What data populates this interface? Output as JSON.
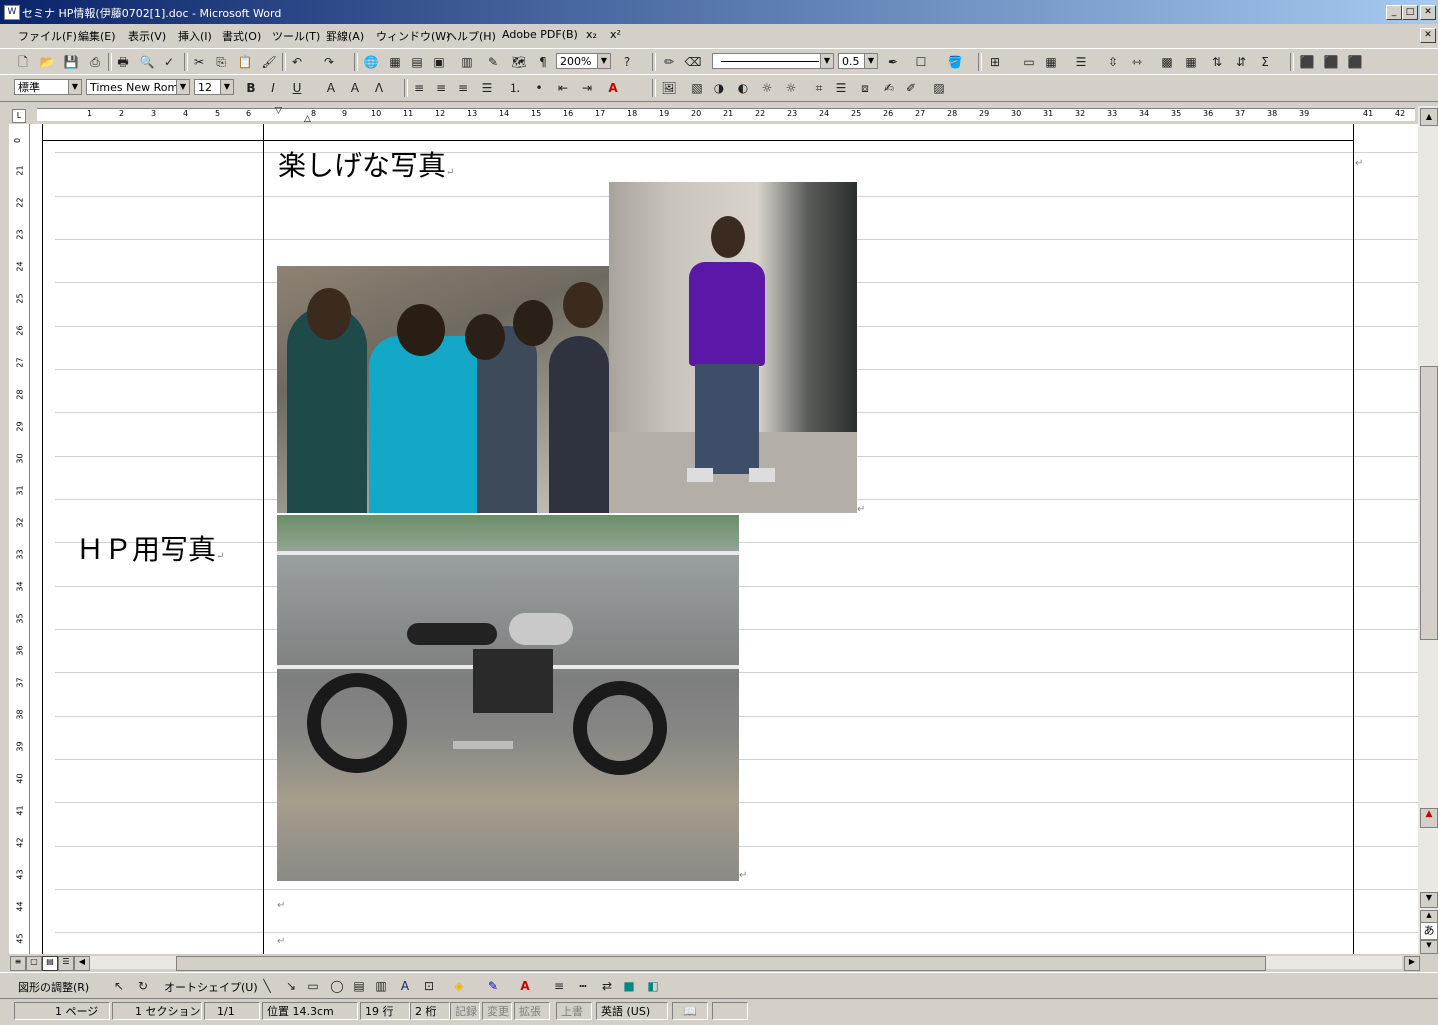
{
  "window": {
    "title": "セミナ HP情報(伊藤0702[1].doc - Microsoft Word"
  },
  "menu": {
    "items": [
      "ファイル(F)",
      "編集(E)",
      "表示(V)",
      "挿入(I)",
      "書式(O)",
      "ツール(T)",
      "罫線(A)",
      "ウィンドウ(W)",
      "ヘルプ(H)",
      "Adobe PDF(B)",
      "x₂",
      "x²"
    ]
  },
  "standard_toolbar": {
    "zoom": "200%",
    "line_width": "0.5"
  },
  "format_toolbar": {
    "style": "標準",
    "font": "Times New Roma",
    "size": "12",
    "bold": "B",
    "italic": "I",
    "underline": "U"
  },
  "ruler": {
    "horizontal": [
      "1",
      "2",
      "3",
      "4",
      "5",
      "6",
      "8",
      "9",
      "10",
      "11",
      "12",
      "13",
      "14",
      "15",
      "16",
      "17",
      "18",
      "19",
      "20",
      "21",
      "22",
      "23",
      "24",
      "25",
      "26",
      "27",
      "28",
      "29",
      "30",
      "31",
      "32",
      "33",
      "34",
      "35",
      "36",
      "37",
      "38",
      "39",
      "41",
      "42"
    ],
    "vertical": [
      "0",
      "21",
      "22",
      "23",
      "24",
      "25",
      "26",
      "27",
      "28",
      "29",
      "30",
      "31",
      "32",
      "33",
      "34",
      "35",
      "36",
      "37",
      "38",
      "39",
      "40",
      "41",
      "42",
      "43",
      "44",
      "45"
    ]
  },
  "document": {
    "heading_fun": "楽しげな写真",
    "label_hp": "ＨＰ用写真",
    "paragraph_mark": "↵"
  },
  "drawing_toolbar": {
    "adjust": "図形の調整(R)",
    "autoshape": "オートシェイプ(U)"
  },
  "status": {
    "page": "1 ページ",
    "section": "1 セクション",
    "pages": "1/1",
    "position": "位置 14.3cm",
    "line": "19 行",
    "column": "2 桁",
    "rec": "記録",
    "trk": "変更",
    "ext": "拡張",
    "ovr": "上書",
    "language": "英語 (US)"
  },
  "scroll_ime": "あ"
}
